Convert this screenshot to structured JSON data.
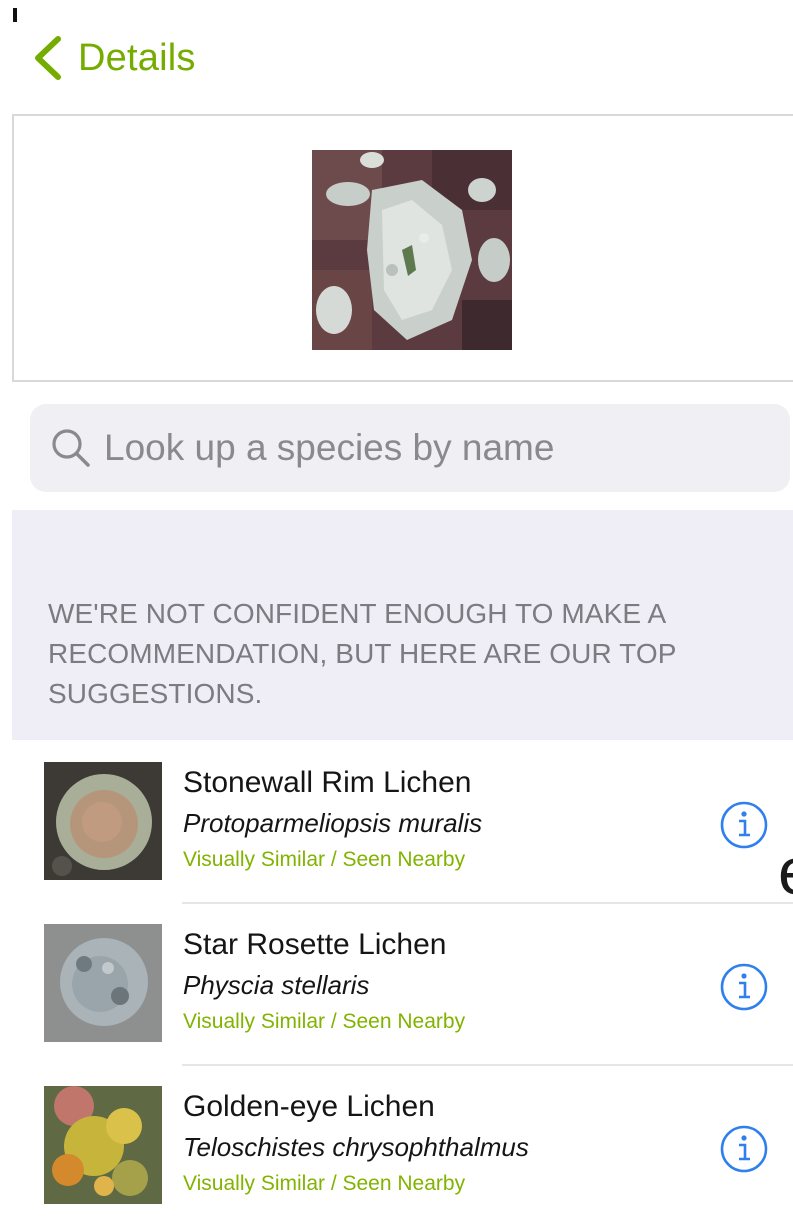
{
  "nav": {
    "back_label": "Details"
  },
  "search": {
    "placeholder": "Look up a species by name",
    "value": ""
  },
  "notice": {
    "text": "We're not confident enough to make a recommendation, but here are our top suggestions."
  },
  "suggestions": [
    {
      "common_name": "Stonewall Rim Lichen",
      "scientific_name": "Protoparmeliopsis muralis",
      "tag": "Visually Similar / Seen Nearby"
    },
    {
      "common_name": "Star Rosette Lichen",
      "scientific_name": "Physcia stellaris",
      "tag": "Visually Similar / Seen Nearby"
    },
    {
      "common_name": "Golden-eye Lichen",
      "scientific_name": "Teloschistes chrysophthalmus",
      "tag": "Visually Similar / Seen Nearby"
    }
  ],
  "edge_fragment": "e",
  "colors": {
    "accent_green": "#74ac00",
    "tag_green": "#82b300",
    "info_blue": "#2f80ed",
    "notice_bg": "#efedf6",
    "search_bg": "#efeff4"
  },
  "icons": {
    "back": "chevron-left-icon",
    "search": "search-icon",
    "info": "info-circle-icon"
  }
}
